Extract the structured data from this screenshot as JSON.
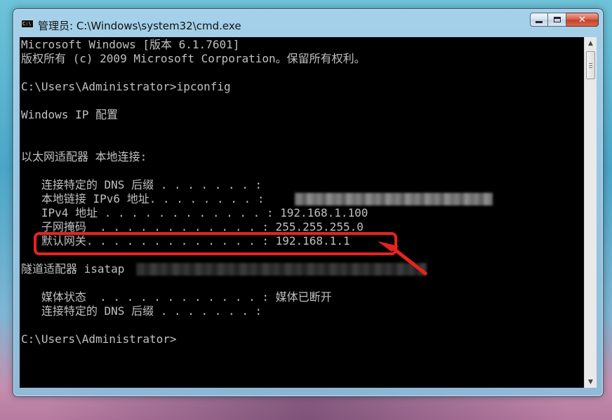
{
  "window": {
    "title": "管理员: C:\\Windows\\system32\\cmd.exe",
    "icon": "cmd-icon",
    "icon_text": "C:\\"
  },
  "caption_buttons": {
    "minimize_icon": "minimize-icon",
    "maximize_icon": "maximize-icon",
    "close_label": "✕"
  },
  "console": {
    "lines": [
      "Microsoft Windows [版本 6.1.7601]",
      "版权所有 (c) 2009 Microsoft Corporation。保留所有权利。",
      "",
      "C:\\Users\\Administrator>ipconfig",
      "",
      "Windows IP 配置",
      "",
      "",
      "以太网适配器 本地连接:",
      "",
      "   连接特定的 DNS 后缀 . . . . . . . :",
      "   本地链接 IPv6 地址. . . . . . . . :",
      "   IPv4 地址 . . . . . . . . . . . . : 192.168.1.100",
      "   子网掩码  . . . . . . . . . . . . : 255.255.255.0",
      "   默认网关. . . . . . . . . . . . . : 192.168.1.1",
      "",
      "隧道适配器 isatap",
      "",
      "   媒体状态  . . . . . . . . . . . . : 媒体已断开",
      "   连接特定的 DNS 后缀 . . . . . . . :",
      "",
      "C:\\Users\\Administrator>"
    ],
    "text_color": "#c0c0c0",
    "background_color": "#000000"
  },
  "annotation": {
    "highlight_color": "#e8231f"
  },
  "scrollbar": {
    "up_icon": "▲",
    "down_icon": "▼"
  }
}
